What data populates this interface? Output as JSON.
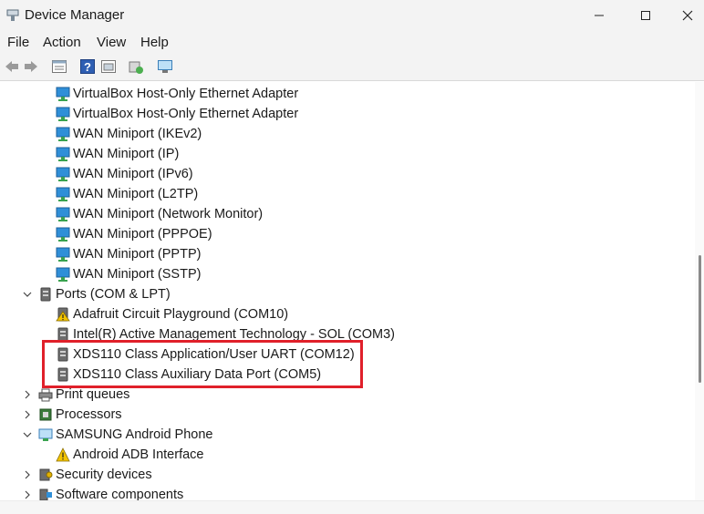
{
  "window": {
    "title": "Device Manager"
  },
  "menu": [
    "File",
    "Action",
    "View",
    "Help"
  ],
  "toolbar": [
    "back-icon",
    "forward-icon",
    "properties-icon",
    "help-icon",
    "show-hidden-icon",
    "update-driver-icon",
    "scan-hardware-icon"
  ],
  "tree": {
    "net_adapters": [
      "VirtualBox Host-Only Ethernet Adapter",
      "VirtualBox Host-Only Ethernet Adapter",
      "WAN Miniport (IKEv2)",
      "WAN Miniport (IP)",
      "WAN Miniport (IPv6)",
      "WAN Miniport (L2TP)",
      "WAN Miniport (Network Monitor)",
      "WAN Miniport (PPPOE)",
      "WAN Miniport (PPTP)",
      "WAN Miniport (SSTP)"
    ],
    "ports": {
      "label": "Ports (COM & LPT)",
      "items": [
        "Adafruit Circuit Playground (COM10)",
        "Intel(R) Active Management Technology - SOL (COM3)",
        "XDS110 Class Application/User UART (COM12)",
        "XDS110 Class Auxiliary Data Port (COM5)"
      ]
    },
    "print_queues": "Print queues",
    "processors": "Processors",
    "samsung": {
      "label": "SAMSUNG Android Phone",
      "items": [
        "Android ADB Interface"
      ]
    },
    "security": "Security devices",
    "software": "Software components"
  },
  "colors": {
    "highlight": "#e0202a",
    "accent": "#1e8bd6"
  }
}
